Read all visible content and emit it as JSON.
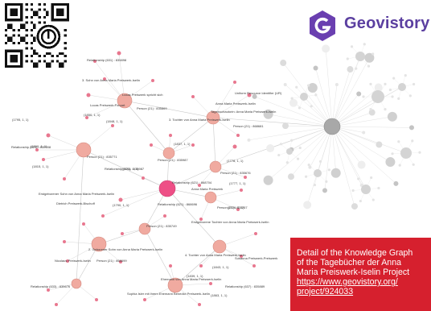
{
  "logo": {
    "brand": "Geovistory",
    "icon": "geovistory-g-icon",
    "brand_color": "#5b3fa0"
  },
  "qr": {
    "icon": "qr-code-icon"
  },
  "caption": {
    "line1": "Detail of the Knowledge Graph",
    "line2": "of the Tagebücher der Anna",
    "line3": "Maria Preiswerk-Iselin Project",
    "link1": "https://www.geovistory.org/",
    "link2": "project/924033",
    "background": "#d6202e"
  },
  "graph": {
    "labels": [
      "Relationship (631) : 835898",
      "3. Sohn von Anna Maria Preiswerk-Iselin",
      "Lucas Preiswerk-Forcart",
      "Lucas Preiswerk spricht sich",
      "Person (21) : 835869",
      "(1848, 1, 1)",
      "Uniform Resource Identifier (UR)",
      "Anna Maria Preiswerk-Iselin",
      "Tagebuchautorin: Anna Maria Preiswerk-Iselin",
      "Person (21) : 868681",
      "3. Tochter von Anna Maria Preiswerk-Iselin",
      "Relationship (621) : 835908",
      "(1795, 1, 1)",
      "Relationship (621) : 835987",
      "(1791, 1, 1)",
      "Person (21) : 835987",
      "Anna Maria Preiswerk",
      "Person (21) : 835676",
      "Relationship (621) : 868696",
      "Person (21) : 835771",
      "Erstgeborener Sohn von Anna Maria Preiswerk-Iselin",
      "Dietrich Preiswerk-Bischoff",
      "Person (21) : 835757",
      "(1777, 1, 1)",
      "(1776, 1, 1)",
      "Erstgeborene Tochter von Anna Maria Preiswerk-Iselin",
      "(1790, 1, 1)",
      "Person (21) : 835749",
      "2. Geborener Sohn von Anna Maria Preiswerk-Iselin",
      "Nicolaus Preiswerk-Iselin",
      "Person (21) : 868699",
      "4. Tochter von Anna Maria Preiswerk-Iselin",
      "Susanna Preiswerk-Preiswerk",
      "(1843, 1, 1)",
      "Relationship (637) : 835889",
      "Ehemann von Anna Maria Preiswerk-Iselin",
      "Relationship (633) : 835676",
      "Sophia Isler mit ihrem Ehemann Benedict Preiswerk-Iselin",
      "(1839, 1, 1)",
      "(1815, 1, 1)",
      "(1850, 1, 1)",
      "(1860, 1, 1)",
      "(1863, 1, 1)",
      "(1837, 1, 1)",
      "(1778, 1, 1)",
      "Relationship (621) : 868704"
    ]
  }
}
